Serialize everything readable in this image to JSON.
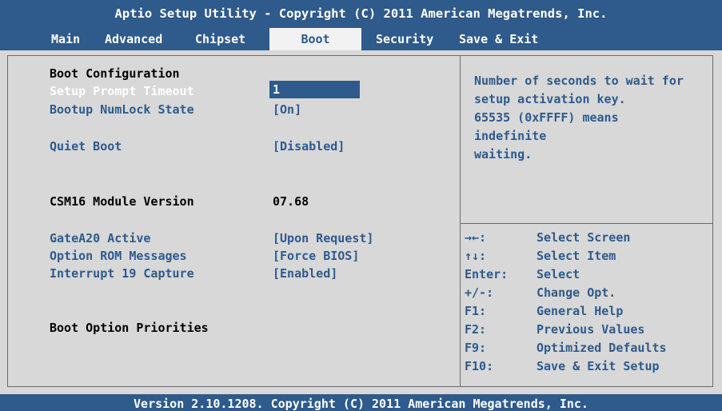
{
  "title": "Aptio Setup Utility - Copyright (C) 2011 American Megatrends, Inc.",
  "tabs": [
    {
      "label": "Main",
      "active": false
    },
    {
      "label": "Advanced",
      "active": false
    },
    {
      "label": "Chipset",
      "active": false
    },
    {
      "label": "Boot",
      "active": true
    },
    {
      "label": "Security",
      "active": false
    },
    {
      "label": "Save & Exit",
      "active": false
    }
  ],
  "settings": {
    "boot_config_heading": "Boot Configuration",
    "setup_prompt_timeout": {
      "label": "Setup Prompt Timeout",
      "value": "1"
    },
    "bootup_numlock": {
      "label": "Bootup NumLock State",
      "value": "[On]"
    },
    "quiet_boot": {
      "label": "Quiet Boot",
      "value": "[Disabled]"
    },
    "csm16": {
      "label": "CSM16 Module Version",
      "value": "07.68"
    },
    "gatea20": {
      "label": "GateA20 Active",
      "value": "[Upon Request]"
    },
    "option_rom": {
      "label": "Option ROM Messages",
      "value": "[Force BIOS]"
    },
    "int19": {
      "label": "Interrupt 19 Capture",
      "value": "[Enabled]"
    },
    "boot_priorities_heading": "Boot Option Priorities"
  },
  "help_text": [
    "Number of seconds to wait for",
    "setup activation key.",
    "65535 (0xFFFF) means",
    "indefinite",
    "waiting."
  ],
  "keys": [
    {
      "key": "→←:",
      "desc": "Select Screen"
    },
    {
      "key": "↑↓:",
      "desc": "Select Item"
    },
    {
      "key": "Enter:",
      "desc": "Select"
    },
    {
      "key": "+/-:",
      "desc": "Change Opt."
    },
    {
      "key": "F1:",
      "desc": "General Help"
    },
    {
      "key": "F2:",
      "desc": "Previous Values"
    },
    {
      "key": "F9:",
      "desc": "Optimized Defaults"
    },
    {
      "key": "F10:",
      "desc": "Save & Exit Setup"
    }
  ],
  "footer": "Version 2.10.1208. Copyright (C) 2011 American Megatrends, Inc.",
  "colors": {
    "accent": "#2e5a8c",
    "panel": "#d8d8d8",
    "active_tab": "#f2f2f2"
  }
}
